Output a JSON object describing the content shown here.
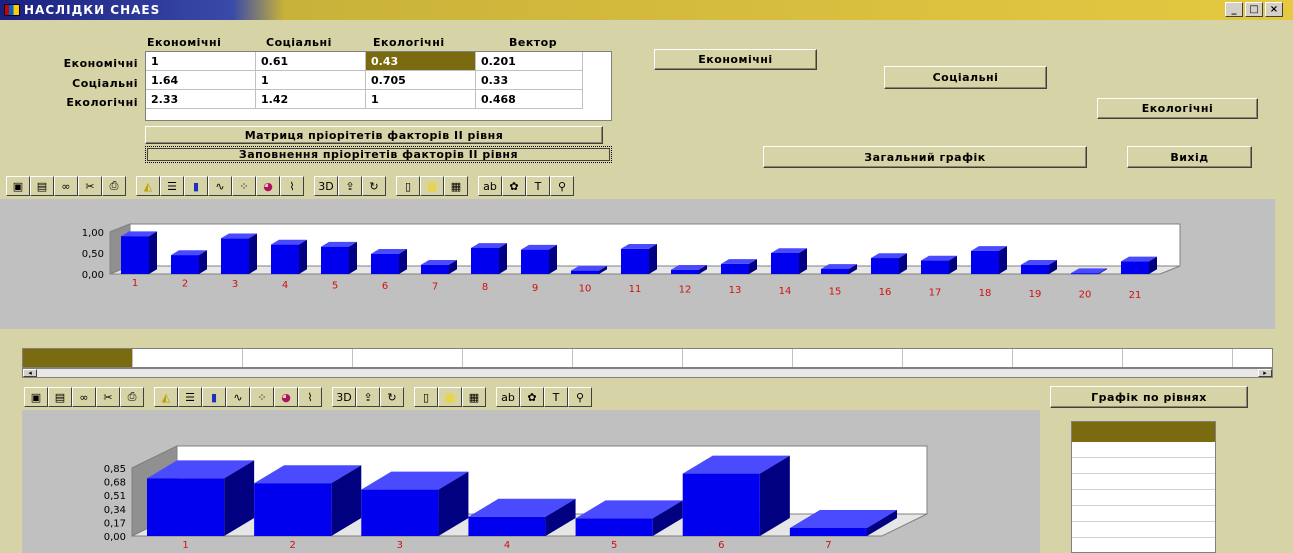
{
  "window": {
    "title": "НАСЛІДКИ    CHAES",
    "min_label": "_",
    "max_label": "□",
    "close_label": "×"
  },
  "matrix": {
    "columns": [
      "Економічні",
      "Соціальні",
      "Екологічні",
      "Вектор"
    ],
    "rows": [
      {
        "label": "Економічні",
        "cells": [
          "1",
          "0.61",
          "0.43",
          "0.201"
        ]
      },
      {
        "label": "Соціальні",
        "cells": [
          "1.64",
          "1",
          "0.705",
          "0.33"
        ]
      },
      {
        "label": "Екологічні",
        "cells": [
          "2.33",
          "1.42",
          "1",
          "0.468"
        ]
      }
    ]
  },
  "buttons": {
    "matrix_priorities": "Матриця   пріорітетів  факторів ІІ рівня",
    "fill_priorities": "Заповнення  пріорітетів  факторів ІІ рівня",
    "economic": "Економічні",
    "social": "Соціальні",
    "ecological": "Екологічні",
    "general_chart": "Загальний графік",
    "exit": "Вихід",
    "chart_by_levels": "Графік по рівнях"
  },
  "toolbar": {
    "icons": [
      "open-icon",
      "save-icon",
      "copy-icon",
      "cut-icon",
      "print-icon",
      "area-chart-icon",
      "hbar-chart-icon",
      "bar-chart-icon",
      "line-chart-icon",
      "scatter-chart-icon",
      "pie-chart-icon",
      "step-chart-icon",
      "3d-icon",
      "stack-icon",
      "rotate-icon",
      "page-icon",
      "fill-icon",
      "grid-icon",
      "label-icon",
      "palette-icon",
      "text-icon",
      "zoom-icon"
    ]
  },
  "colors": {
    "bar_front": "#0000ee",
    "bar_top": "#4a4aff",
    "bar_side": "#000080",
    "label_red": "#d01010",
    "selection": "#7a6a10",
    "panel_bg": "#c0c0c0",
    "window_bg": "#d6d3a6"
  },
  "chart_data": [
    {
      "type": "bar",
      "categories": [
        "1",
        "2",
        "3",
        "4",
        "5",
        "6",
        "7",
        "8",
        "9",
        "10",
        "11",
        "12",
        "13",
        "14",
        "15",
        "16",
        "17",
        "18",
        "19",
        "20",
        "21"
      ],
      "values": [
        0.9,
        0.45,
        0.85,
        0.7,
        0.65,
        0.48,
        0.22,
        0.62,
        0.58,
        0.08,
        0.6,
        0.1,
        0.24,
        0.5,
        0.12,
        0.38,
        0.32,
        0.55,
        0.22,
        0.02,
        0.3
      ],
      "yticks": [
        "1,00",
        "0,50",
        "0,00"
      ],
      "ylim": [
        0,
        1
      ],
      "style": "3d"
    },
    {
      "type": "bar",
      "categories": [
        "1",
        "2",
        "3",
        "4",
        "5",
        "6",
        "7"
      ],
      "values": [
        0.72,
        0.66,
        0.58,
        0.24,
        0.22,
        0.78,
        0.1
      ],
      "yticks": [
        "0,85",
        "0,68",
        "0,51",
        "0,34",
        "0,17",
        "0,00"
      ],
      "ylim": [
        0,
        0.85
      ],
      "style": "3d"
    }
  ]
}
